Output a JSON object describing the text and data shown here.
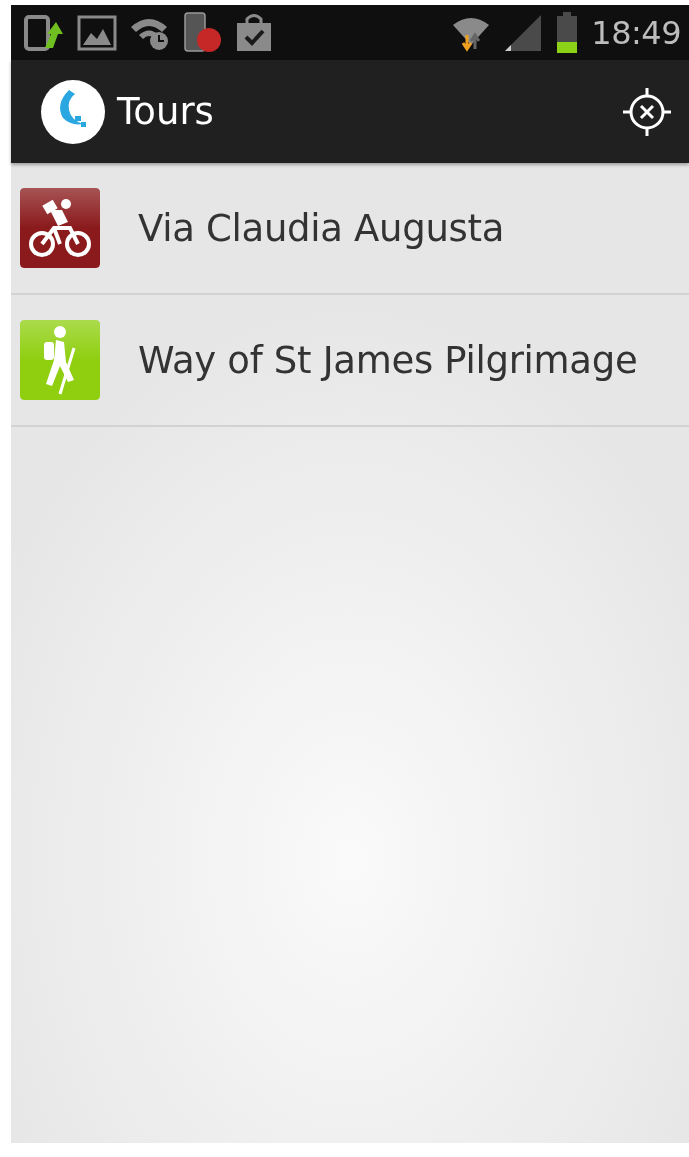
{
  "status_bar": {
    "time": "18:49"
  },
  "action_bar": {
    "title": "Tours"
  },
  "tours": [
    {
      "name": "Via Claudia Augusta",
      "kind": "cycling",
      "color": "#8a1a1c"
    },
    {
      "name": "Way of St James Pilgrimage",
      "kind": "hiking",
      "color": "#8fcf10"
    }
  ]
}
